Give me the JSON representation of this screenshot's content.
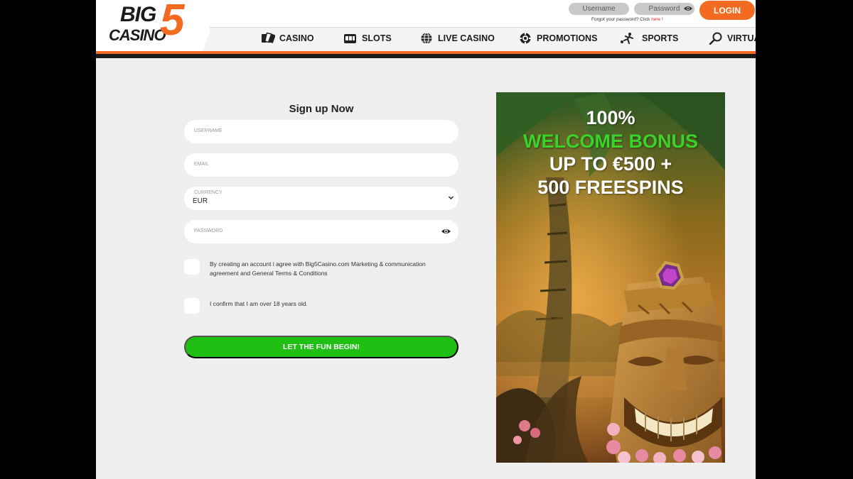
{
  "header": {
    "logo": {
      "big": "BIG",
      "casino": "CASINO",
      "five": "5"
    },
    "login": {
      "username_placeholder": "Username",
      "password_placeholder": "Password",
      "login_label": "LOGIN",
      "forgot_text": "Forgot your password? Click",
      "forgot_link": "here",
      "forgot_suffix": "!"
    },
    "nav": [
      {
        "label": "CASINO",
        "icon": "cards-icon"
      },
      {
        "label": "SLOTS",
        "icon": "slot-machine-icon"
      },
      {
        "label": "LIVE CASINO",
        "icon": "globe-icon"
      },
      {
        "label": "PROMOTIONS",
        "icon": "gift-chip-icon"
      },
      {
        "label": "SPORTS",
        "icon": "soccer-player-icon"
      },
      {
        "label": "VIRTUA",
        "icon": "racket-icon"
      }
    ],
    "accent_color": "#f26b21"
  },
  "form": {
    "title": "Sign up Now",
    "username_placeholder": "USERNAME",
    "email_placeholder": "EMAIL",
    "currency_label": "CURRENCY",
    "currency_value": "EUR",
    "password_placeholder": "PASSWORD",
    "terms_text_line1": "By creating an account i agree with Big5Casino.com Marketing & communication",
    "terms_text_line2": "agreement and General Terms & Conditions",
    "age_text": "I confirm that I am over 18 years old.",
    "submit_label": "LET THE FUN BEGIN!",
    "submit_color": "#1fbf14"
  },
  "banner": {
    "line1": "100%",
    "line2": "WELCOME BONUS",
    "line3": "UP TO €500 +",
    "line4": "500 FREESPINS"
  }
}
